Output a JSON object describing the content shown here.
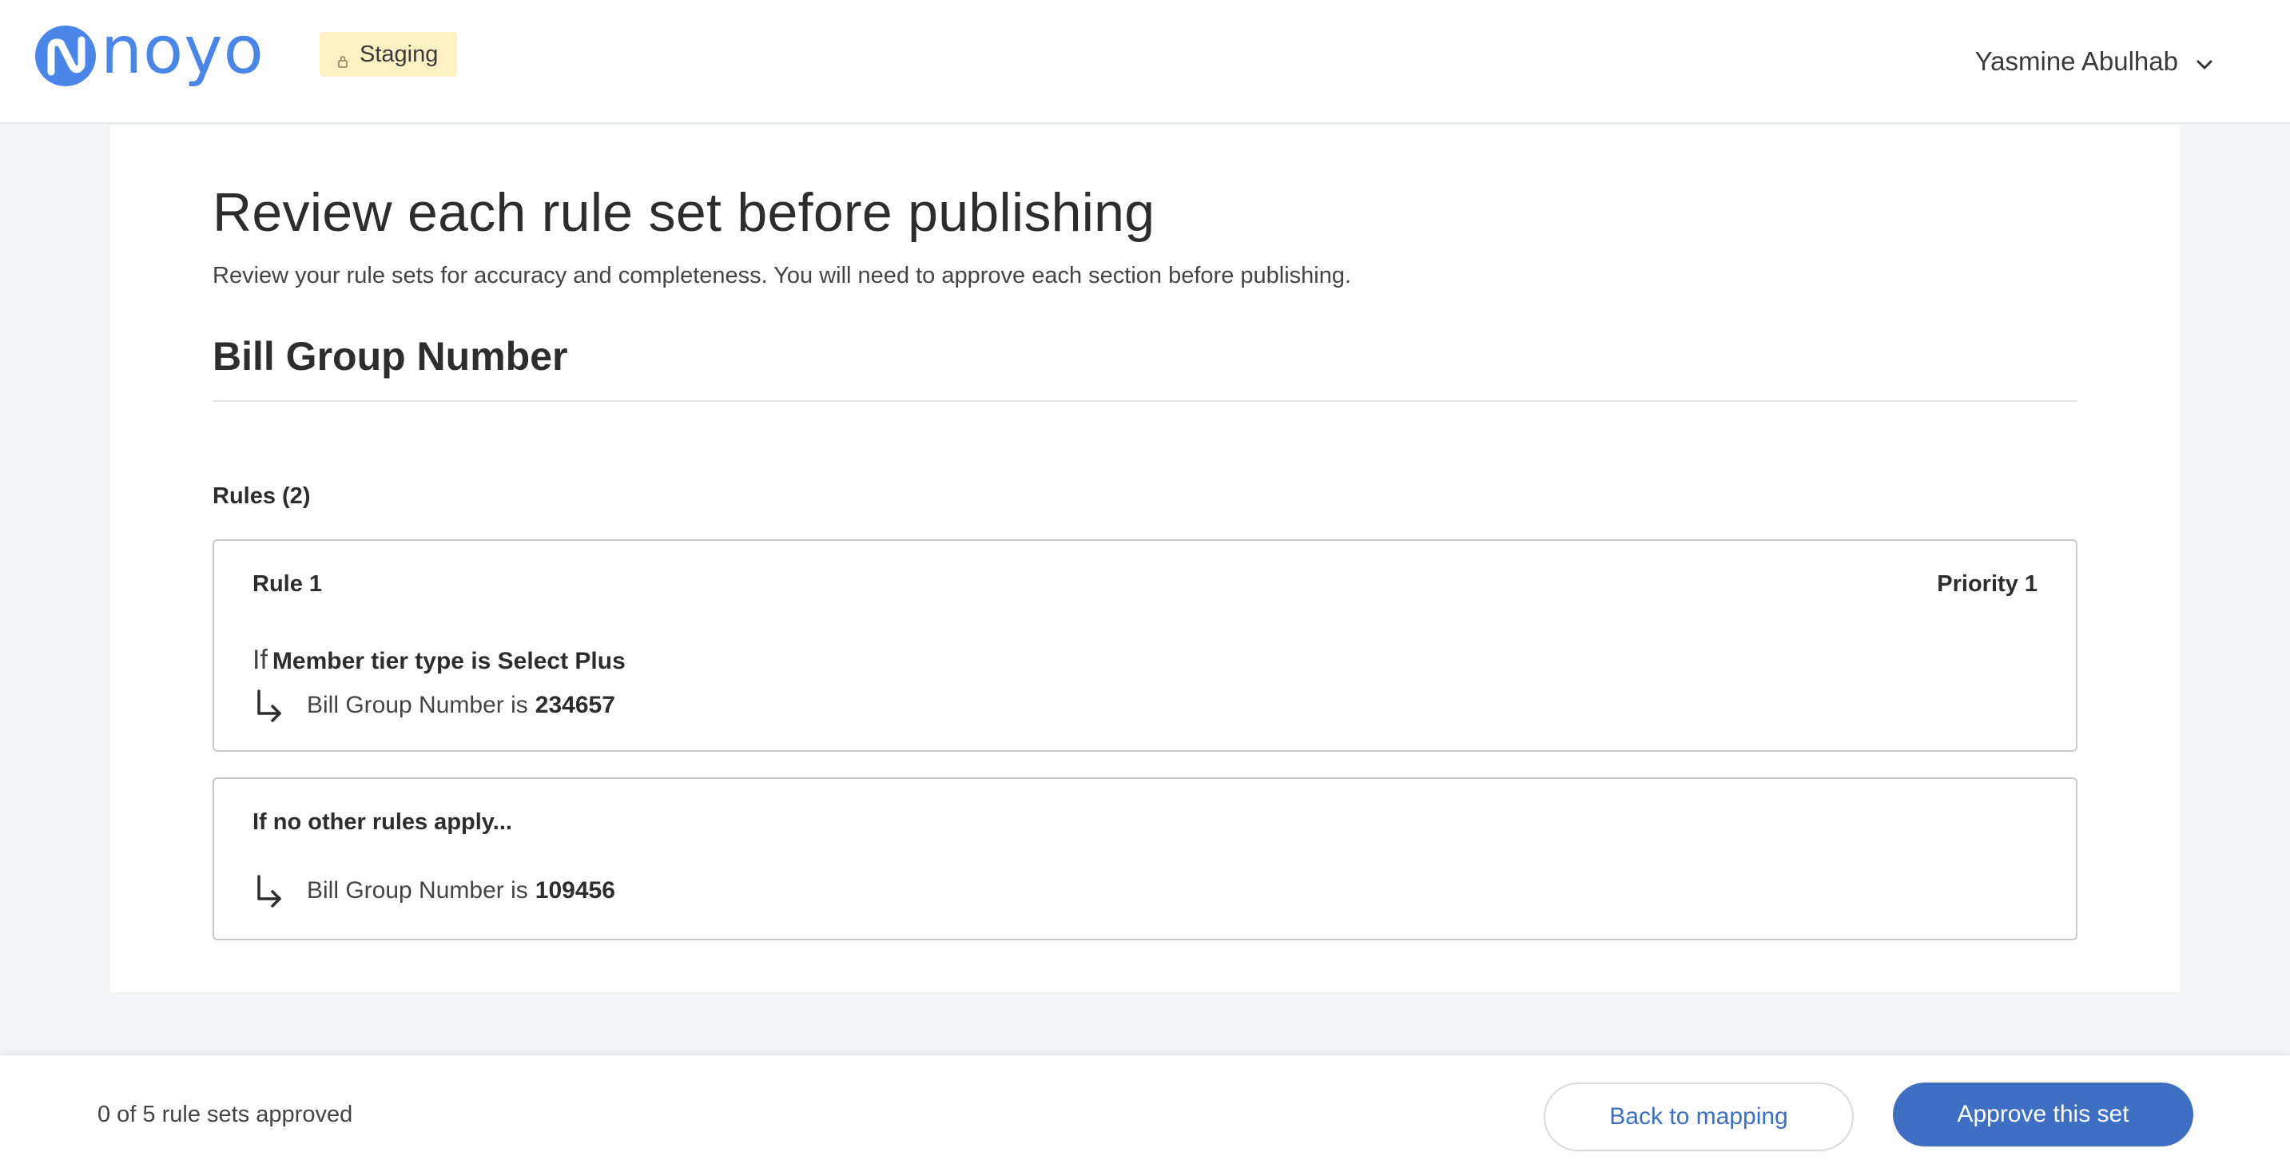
{
  "header": {
    "logo_text": "noyo",
    "environment": "Staging",
    "user_name": "Yasmine Abulhab"
  },
  "main": {
    "title": "Review each rule set before publishing",
    "subtitle": "Review your rule sets for accuracy and completeness. You will need to approve each section before publishing.",
    "section_title": "Bill Group Number",
    "rules_count": "Rules (2)",
    "rules": [
      {
        "label": "Rule 1",
        "priority": "Priority 1",
        "condition_prefix": "If",
        "condition": "Member tier type is Select Plus",
        "outcome_text": "Bill Group Number is",
        "outcome_value": "234657"
      }
    ],
    "default_rule": {
      "label": "If no other rules apply...",
      "outcome_text": "Bill Group Number is",
      "outcome_value": "109456"
    }
  },
  "footer": {
    "approved_status": "0 of 5 rule sets approved",
    "back_label": "Back to mapping",
    "approve_label": "Approve this set"
  },
  "colors": {
    "brand": "#4a86e8",
    "primary_button": "#3e6fc2",
    "badge_bg": "#fdf0c2"
  },
  "icons": {
    "logo": "noyo-logo-icon",
    "badge": "lock-icon",
    "user_menu": "chevron-down-icon",
    "outcome": "arrow-turn-down-right-icon"
  }
}
